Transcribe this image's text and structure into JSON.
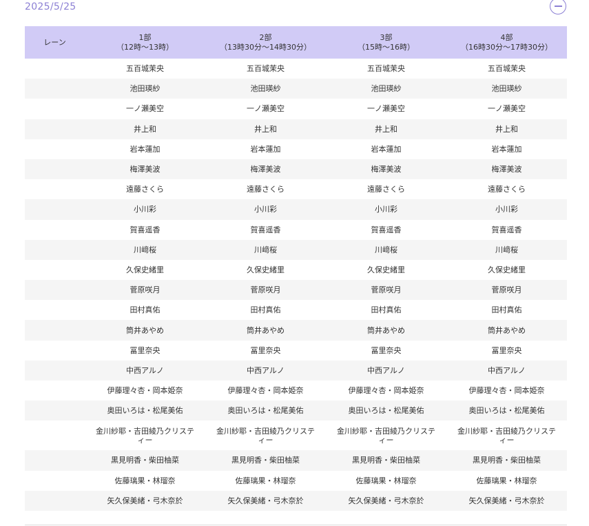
{
  "date": "2025/5/25",
  "header": {
    "lane": "レーン",
    "parts": [
      {
        "name": "1部",
        "time": "（12時～13時）"
      },
      {
        "name": "2部",
        "time": "（13時30分～14時30分）"
      },
      {
        "name": "3部",
        "time": "（15時～16時）"
      },
      {
        "name": "4部",
        "time": "（16時30分～17時30分）"
      }
    ]
  },
  "rows": [
    [
      "五百城茉央",
      "五百城茉央",
      "五百城茉央",
      "五百城茉央"
    ],
    [
      "池田瑛紗",
      "池田瑛紗",
      "池田瑛紗",
      "池田瑛紗"
    ],
    [
      "一ノ瀬美空",
      "一ノ瀬美空",
      "一ノ瀬美空",
      "一ノ瀬美空"
    ],
    [
      "井上和",
      "井上和",
      "井上和",
      "井上和"
    ],
    [
      "岩本蓮加",
      "岩本蓮加",
      "岩本蓮加",
      "岩本蓮加"
    ],
    [
      "梅澤美波",
      "梅澤美波",
      "梅澤美波",
      "梅澤美波"
    ],
    [
      "遠藤さくら",
      "遠藤さくら",
      "遠藤さくら",
      "遠藤さくら"
    ],
    [
      "小川彩",
      "小川彩",
      "小川彩",
      "小川彩"
    ],
    [
      "賀喜遥香",
      "賀喜遥香",
      "賀喜遥香",
      "賀喜遥香"
    ],
    [
      "川﨑桜",
      "川﨑桜",
      "川﨑桜",
      "川﨑桜"
    ],
    [
      "久保史緒里",
      "久保史緒里",
      "久保史緒里",
      "久保史緒里"
    ],
    [
      "菅原咲月",
      "菅原咲月",
      "菅原咲月",
      "菅原咲月"
    ],
    [
      "田村真佑",
      "田村真佑",
      "田村真佑",
      "田村真佑"
    ],
    [
      "筒井あやめ",
      "筒井あやめ",
      "筒井あやめ",
      "筒井あやめ"
    ],
    [
      "冨里奈央",
      "冨里奈央",
      "冨里奈央",
      "冨里奈央"
    ],
    [
      "中西アルノ",
      "中西アルノ",
      "中西アルノ",
      "中西アルノ"
    ],
    [
      "伊藤理々杏・岡本姫奈",
      "伊藤理々杏・岡本姫奈",
      "伊藤理々杏・岡本姫奈",
      "伊藤理々杏・岡本姫奈"
    ],
    [
      "奥田いろは・松尾美佑",
      "奥田いろは・松尾美佑",
      "奥田いろは・松尾美佑",
      "奥田いろは・松尾美佑"
    ],
    [
      "金川紗耶・吉田綾乃クリスティー",
      "金川紗耶・吉田綾乃クリスティー",
      "金川紗耶・吉田綾乃クリスティー",
      "金川紗耶・吉田綾乃クリスティー"
    ],
    [
      "黒見明香・柴田柚菜",
      "黒見明香・柴田柚菜",
      "黒見明香・柴田柚菜",
      "黒見明香・柴田柚菜"
    ],
    [
      "佐藤璃果・林瑠奈",
      "佐藤璃果・林瑠奈",
      "佐藤璃果・林瑠奈",
      "佐藤璃果・林瑠奈"
    ],
    [
      "矢久保美緒・弓木奈於",
      "矢久保美緒・弓木奈於",
      "矢久保美緒・弓木奈於",
      "矢久保美緒・弓木奈於"
    ]
  ]
}
